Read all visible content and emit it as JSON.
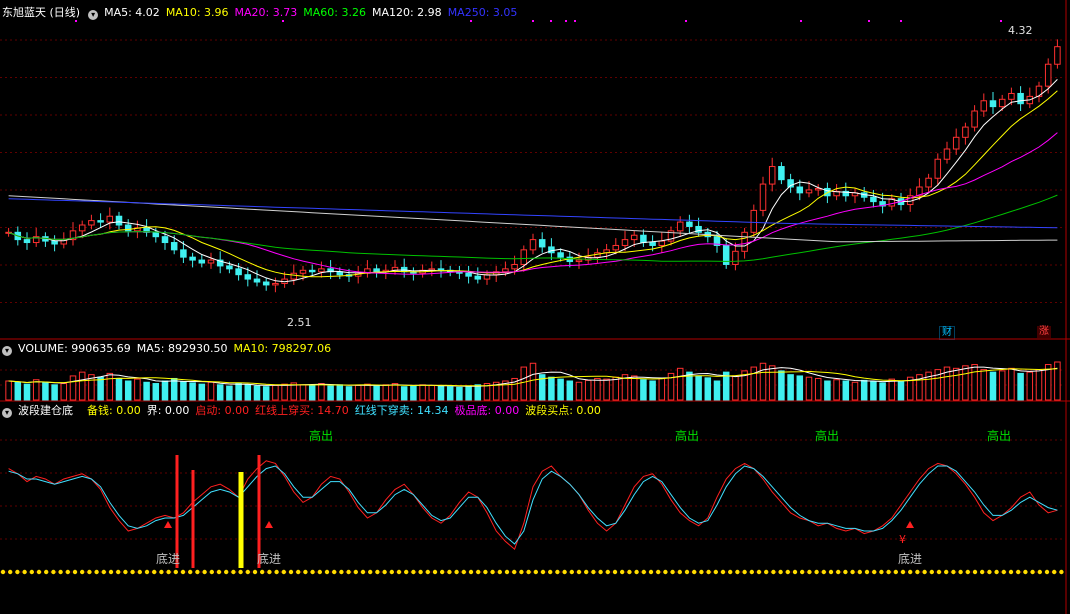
{
  "main_panel": {
    "title": "东旭蓝天 (日线)",
    "ma": [
      {
        "label": "MA5: 4.02",
        "color": "#ffffff"
      },
      {
        "label": "MA10: 3.96",
        "color": "#ffff00"
      },
      {
        "label": "MA20: 3.73",
        "color": "#ff00ff"
      },
      {
        "label": "MA60: 3.26",
        "color": "#00ff00"
      },
      {
        "label": "MA120: 2.98",
        "color": "#ffffff"
      },
      {
        "label": "MA250: 3.05",
        "color": "#3333ff"
      }
    ],
    "high_label": "4.32",
    "low_label": "2.51",
    "badge_cai": "财",
    "badge_zhang": "涨"
  },
  "volume_panel": {
    "items": [
      {
        "label": "VOLUME: 990635.69",
        "color": "#ffffff"
      },
      {
        "label": "MA5: 892930.50",
        "color": "#ffffff"
      },
      {
        "label": "MA10: 798297.06",
        "color": "#ffff00"
      }
    ]
  },
  "indicator_panel": {
    "title": "波段建仓底",
    "items": [
      {
        "label": "备钱: 0.00",
        "color": "#ffff00"
      },
      {
        "label": "界: 0.00",
        "color": "#ffffff"
      },
      {
        "label": "启动: 0.00",
        "color": "#ff2020"
      },
      {
        "label": "红线上穿买: 14.70",
        "color": "#ff2020"
      },
      {
        "label": "红线下穿卖: 14.34",
        "color": "#40e0ff"
      },
      {
        "label": "极品底: 0.00",
        "color": "#ff00ff"
      },
      {
        "label": "波段买点: 0.00",
        "color": "#ffff00"
      }
    ],
    "top_label": "高出",
    "bottom_label": "底进",
    "yen_label": "¥"
  },
  "chart_data": {
    "type": "candlestick",
    "close": [
      3.05,
      3.0,
      2.98,
      3.02,
      2.99,
      2.97,
      3.0,
      3.06,
      3.1,
      3.13,
      3.12,
      3.16,
      3.1,
      3.06,
      3.08,
      3.05,
      3.02,
      2.98,
      2.93,
      2.88,
      2.86,
      2.84,
      2.86,
      2.82,
      2.8,
      2.76,
      2.73,
      2.71,
      2.69,
      2.7,
      2.73,
      2.77,
      2.79,
      2.78,
      2.8,
      2.78,
      2.76,
      2.75,
      2.77,
      2.8,
      2.78,
      2.79,
      2.81,
      2.78,
      2.77,
      2.79,
      2.8,
      2.79,
      2.78,
      2.77,
      2.75,
      2.73,
      2.76,
      2.78,
      2.8,
      2.83,
      2.93,
      3.0,
      2.95,
      2.91,
      2.88,
      2.85,
      2.86,
      2.88,
      2.91,
      2.93,
      2.96,
      3.0,
      3.03,
      2.98,
      2.96,
      2.99,
      3.06,
      3.12,
      3.09,
      3.05,
      3.02,
      2.96,
      2.83,
      2.92,
      3.05,
      3.2,
      3.38,
      3.5,
      3.41,
      3.36,
      3.32,
      3.34,
      3.35,
      3.3,
      3.33,
      3.3,
      3.32,
      3.29,
      3.26,
      3.23,
      3.28,
      3.24,
      3.3,
      3.36,
      3.42,
      3.55,
      3.62,
      3.7,
      3.77,
      3.88,
      3.95,
      3.91,
      3.96,
      4.0,
      3.93,
      3.98,
      4.05,
      4.2,
      4.32
    ],
    "ylim": [
      2.45,
      4.4
    ],
    "volume": [
      30,
      28,
      25,
      32,
      27,
      24,
      26,
      38,
      44,
      40,
      36,
      42,
      34,
      30,
      33,
      28,
      26,
      30,
      34,
      29,
      27,
      25,
      28,
      24,
      22,
      26,
      24,
      22,
      21,
      23,
      25,
      27,
      24,
      23,
      26,
      22,
      24,
      21,
      23,
      25,
      22,
      24,
      26,
      21,
      22,
      24,
      23,
      22,
      21,
      20,
      22,
      24,
      26,
      28,
      30,
      34,
      52,
      58,
      40,
      36,
      33,
      30,
      28,
      31,
      34,
      33,
      36,
      40,
      38,
      32,
      30,
      34,
      42,
      50,
      44,
      38,
      35,
      30,
      44,
      38,
      46,
      52,
      58,
      54,
      46,
      40,
      38,
      36,
      34,
      30,
      32,
      30,
      28,
      31,
      29,
      27,
      33,
      30,
      36,
      40,
      44,
      48,
      52,
      50,
      54,
      56,
      48,
      44,
      46,
      50,
      42,
      44,
      48,
      56,
      60
    ],
    "indicator_red": [
      78,
      74,
      68,
      72,
      70,
      66,
      70,
      72,
      74,
      70,
      62,
      48,
      38,
      30,
      32,
      36,
      40,
      42,
      40,
      44,
      52,
      58,
      64,
      66,
      62,
      56,
      70,
      78,
      84,
      82,
      72,
      60,
      52,
      56,
      66,
      72,
      70,
      60,
      48,
      40,
      44,
      54,
      62,
      66,
      58,
      48,
      40,
      36,
      42,
      52,
      60,
      56,
      44,
      30,
      22,
      16,
      36,
      64,
      76,
      80,
      72,
      66,
      58,
      46,
      36,
      30,
      36,
      50,
      64,
      72,
      74,
      66,
      54,
      44,
      38,
      34,
      40,
      56,
      70,
      78,
      82,
      78,
      70,
      60,
      52,
      44,
      40,
      38,
      34,
      36,
      32,
      30,
      32,
      28,
      30,
      34,
      40,
      50,
      60,
      70,
      78,
      82,
      80,
      74,
      66,
      56,
      44,
      38,
      42,
      48,
      56,
      60,
      50,
      44,
      46
    ],
    "indicator_cyan": [
      76,
      74,
      70,
      70,
      68,
      66,
      68,
      70,
      72,
      70,
      64,
      52,
      42,
      34,
      32,
      34,
      38,
      40,
      40,
      42,
      48,
      54,
      60,
      62,
      60,
      56,
      64,
      72,
      78,
      80,
      74,
      64,
      56,
      56,
      62,
      68,
      68,
      62,
      52,
      44,
      44,
      50,
      58,
      62,
      58,
      50,
      42,
      38,
      40,
      48,
      56,
      56,
      48,
      36,
      26,
      20,
      30,
      54,
      70,
      76,
      72,
      66,
      58,
      48,
      40,
      34,
      36,
      46,
      58,
      68,
      72,
      68,
      58,
      48,
      40,
      36,
      38,
      50,
      64,
      74,
      80,
      78,
      72,
      64,
      56,
      48,
      42,
      38,
      36,
      36,
      34,
      32,
      32,
      30,
      30,
      32,
      38,
      46,
      56,
      66,
      74,
      80,
      80,
      76,
      68,
      60,
      50,
      42,
      42,
      46,
      52,
      56,
      52,
      48,
      46
    ]
  }
}
